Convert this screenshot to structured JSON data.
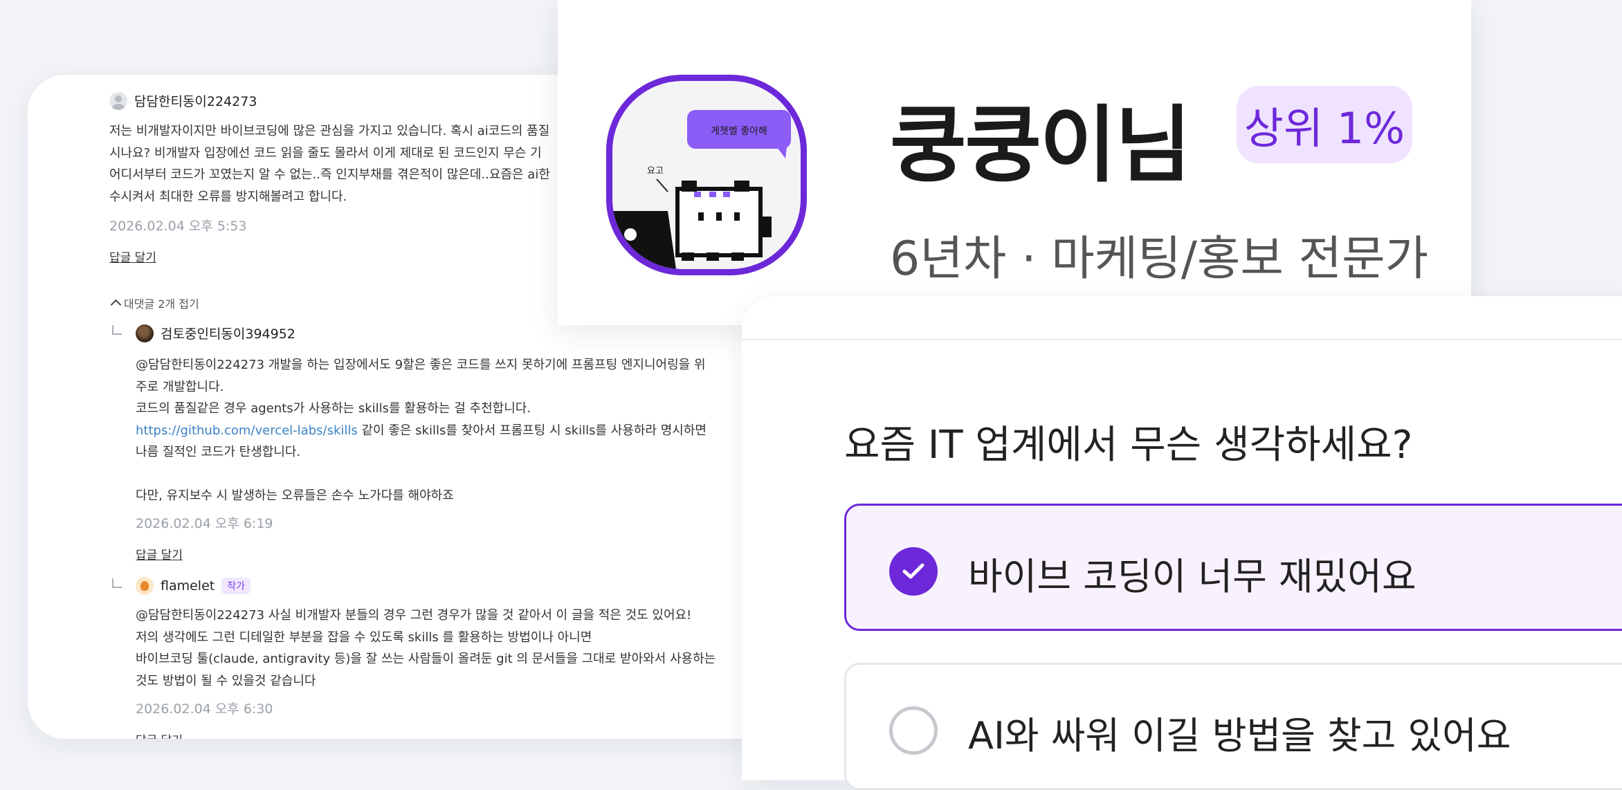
{
  "comments": {
    "main": {
      "author": "담담한티동이224273",
      "text": "저는 비개발자이지만 바이브코딩에 많은 관심을 가지고 있습니다. 혹시 ai코드의 품질\n시나요? 비개발자 입장에선 코드 읽을 줄도 몰라서 이게 제대로 된 코드인지 무슨 기\n어디서부터 코드가 꼬였는지 알 수 없는..즉 인지부채를 겪은적이 많은데..요즘은 ai한\n수시켜서 최대한 오류를 방지해볼려고 합니다.",
      "date": "2026.02.04 오후 5:53",
      "reply_label": "답글 달기"
    },
    "collapse_label": "대댓글 2개 접기",
    "replies": [
      {
        "author": "검토중인티동이394952",
        "mention": "@담담한티동이224273",
        "text_line1": " 개발을 하는 입장에서도 9할은 좋은 코드를 쓰지 못하기에 프롬프팅 엔지니어링을 위",
        "text_line2": "주로 개발합니다.",
        "text_line3": "코드의 품질같은 경우 agents가 사용하는 skills를 활용하는 걸 추천합니다.",
        "link": "https://github.com/vercel-labs/skills",
        "text_line4": " 같이 좋은 skills를 찾아서 프롬프팅 시 skills를 사용하라 명시하면",
        "text_line5": "나름 질적인 코드가 탄생합니다.",
        "text_line6": "다만, 유지보수 시 발생하는 오류들은 손수 노가다를 해야하죠",
        "date": "2026.02.04 오후 6:19",
        "reply_label": "답글 달기"
      },
      {
        "author": "flamelet",
        "badge": "작가",
        "mention": "@담담한티동이224273",
        "text_line1": " 사실 비개발자 분들의 경우 그런 경우가 많을 것 같아서 이 글을 적은 것도 있어요!",
        "text_line2": "저의 생각에도 그런 디테일한 부분을 잡을 수 있도록 skills 를 활용하는 방법이나 아니면",
        "text_line3": "바이브코딩 툴(claude, antigravity 등)을 잘 쓰는 사람들이 올려둔 git 의 문서들을 그대로 받아와서 사용하는",
        "text_line4": "것도 방법이 될 수 있을것 같습니다",
        "date": "2026.02.04 오후 6:30",
        "reply_label": "답글 달기"
      }
    ]
  },
  "profile": {
    "name": "쿵쿵이님",
    "rank": "상위 1%",
    "subtitle": "6년차 · 마케팅/홍보 전문가",
    "avatar_speech": "게젯벨 좋아해",
    "avatar_small_label": "요고"
  },
  "poll": {
    "question": "요즘 IT 업계에서 무슨 생각하세요?",
    "options": [
      {
        "label": "바이브 코딩이 너무 재밌어요",
        "selected": true
      },
      {
        "label": "AI와 싸워 이길 방법을 찾고 있어요",
        "selected": false
      }
    ]
  },
  "colors": {
    "accent": "#6d28d9",
    "accent_light": "#efe3ff",
    "link": "#3b82c4"
  }
}
